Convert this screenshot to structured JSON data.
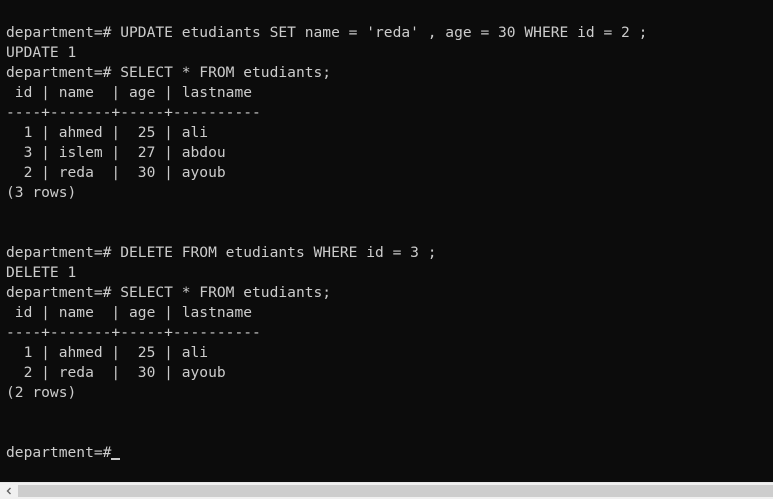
{
  "terminal": {
    "lines": [
      "department=# UPDATE etudiants SET name = 'reda' , age = 30 WHERE id = 2 ;",
      "UPDATE 1",
      "department=# SELECT * FROM etudiants;",
      " id | name  | age | lastname",
      "----+-------+-----+----------",
      "  1 | ahmed |  25 | ali",
      "  3 | islem |  27 | abdou",
      "  2 | reda  |  30 | ayoub",
      "(3 rows)",
      "",
      "",
      "department=# DELETE FROM etudiants WHERE id = 3 ;",
      "DELETE 1",
      "department=# SELECT * FROM etudiants;",
      " id | name  | age | lastname",
      "----+-------+-----+----------",
      "  1 | ahmed |  25 | ali",
      "  2 | reda  |  30 | ayoub",
      "(2 rows)",
      "",
      ""
    ],
    "prompt": "department=#"
  },
  "scrollbar": {
    "left_arrow_icon": "chevron-left-icon"
  },
  "colors": {
    "background": "#0c0c0c",
    "text": "#cccccc",
    "scrollbar_track": "#f0f0f0",
    "scrollbar_thumb": "#cdcdcd"
  }
}
